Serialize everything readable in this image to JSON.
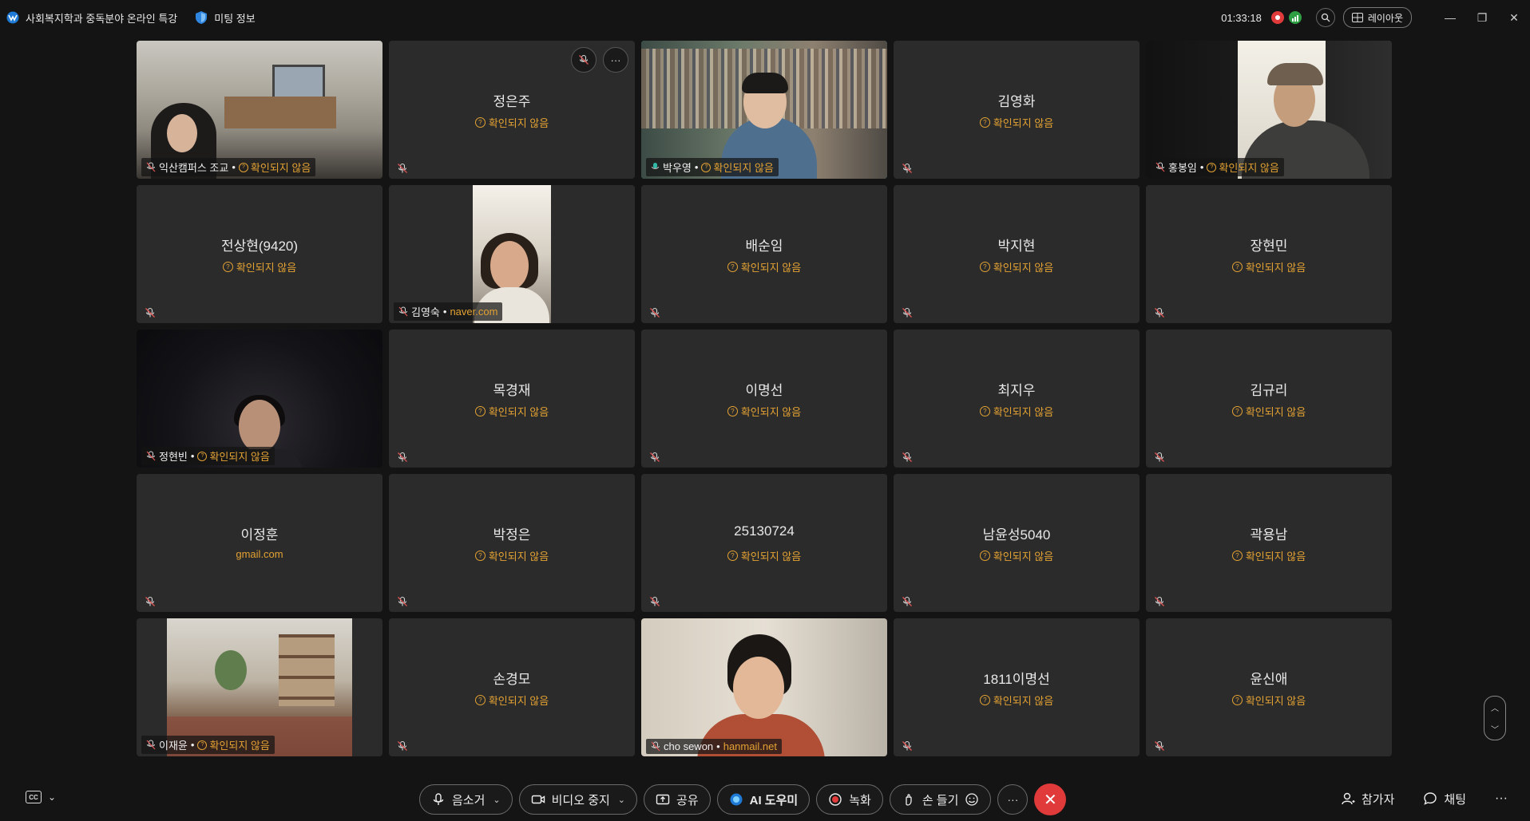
{
  "titlebar": {
    "meeting_title": "사회복지학과 중독분야 온라인 특강",
    "meeting_info": "미팅 정보",
    "timer": "01:33:18",
    "layout_label": "레이아웃",
    "colors": {
      "recording": "#e03a3a",
      "health": "#2ea043"
    }
  },
  "participants": [
    {
      "name": "익산캠퍼스 조교",
      "status": "확인되지 않음",
      "video": true,
      "scene": "office"
    },
    {
      "name": "정은주",
      "status": "확인되지 않음",
      "video": false
    },
    {
      "name": "박우영",
      "status": "확인되지 않음",
      "video": true,
      "scene": "shelf",
      "active_speaker": true
    },
    {
      "name": "김영화",
      "status": "확인되지 않음",
      "video": false
    },
    {
      "name": "홍봉임",
      "status": "확인되지 않음",
      "video": true,
      "scene": "dark"
    },
    {
      "name": "전상현(9420)",
      "status": "확인되지 않음",
      "video": false
    },
    {
      "name": "김영숙",
      "status": "naver.com",
      "video": true,
      "scene": "portrait"
    },
    {
      "name": "배순임",
      "status": "확인되지 않음",
      "video": false
    },
    {
      "name": "박지현",
      "status": "확인되지 않음",
      "video": false
    },
    {
      "name": "장현민",
      "status": "확인되지 않음",
      "video": false
    },
    {
      "name": "정현빈",
      "status": "확인되지 않음",
      "video": true,
      "scene": "night"
    },
    {
      "name": "목경재",
      "status": "확인되지 않음",
      "video": false
    },
    {
      "name": "이명선",
      "status": "확인되지 않음",
      "video": false
    },
    {
      "name": "최지우",
      "status": "확인되지 않음",
      "video": false
    },
    {
      "name": "김규리",
      "status": "확인되지 않음",
      "video": false
    },
    {
      "name": "이정훈",
      "status": "gmail.com",
      "video": false
    },
    {
      "name": "박정은",
      "status": "확인되지 않음",
      "video": false
    },
    {
      "name": "25130724",
      "status": "확인되지 않음",
      "video": false
    },
    {
      "name": "남윤성5040",
      "status": "확인되지 않음",
      "video": false
    },
    {
      "name": "곽용남",
      "status": "확인되지 않음",
      "video": false
    },
    {
      "name": "이재윤",
      "status": "확인되지 않음",
      "video": true,
      "scene": "room"
    },
    {
      "name": "손경모",
      "status": "확인되지 않음",
      "video": false
    },
    {
      "name": "cho sewon",
      "status": "hanmail.net",
      "video": true,
      "scene": "wall"
    },
    {
      "name": "1811이명선",
      "status": "확인되지 않음",
      "video": false
    },
    {
      "name": "윤신애",
      "status": "확인되지 않음",
      "video": false
    }
  ],
  "tile_hover_buttons": {
    "mute_icon": "mic-off-icon",
    "more": "···"
  },
  "toolbar": {
    "mute_label": "음소거",
    "video_label": "비디오 중지",
    "share_label": "공유",
    "ai_label": "AI 도우미",
    "record_label": "녹화",
    "raise_hand_label": "손 들기",
    "more_label": "···",
    "participants_label": "참가자",
    "chat_label": "채팅",
    "overflow_label": "···",
    "cc_label": "CC"
  }
}
